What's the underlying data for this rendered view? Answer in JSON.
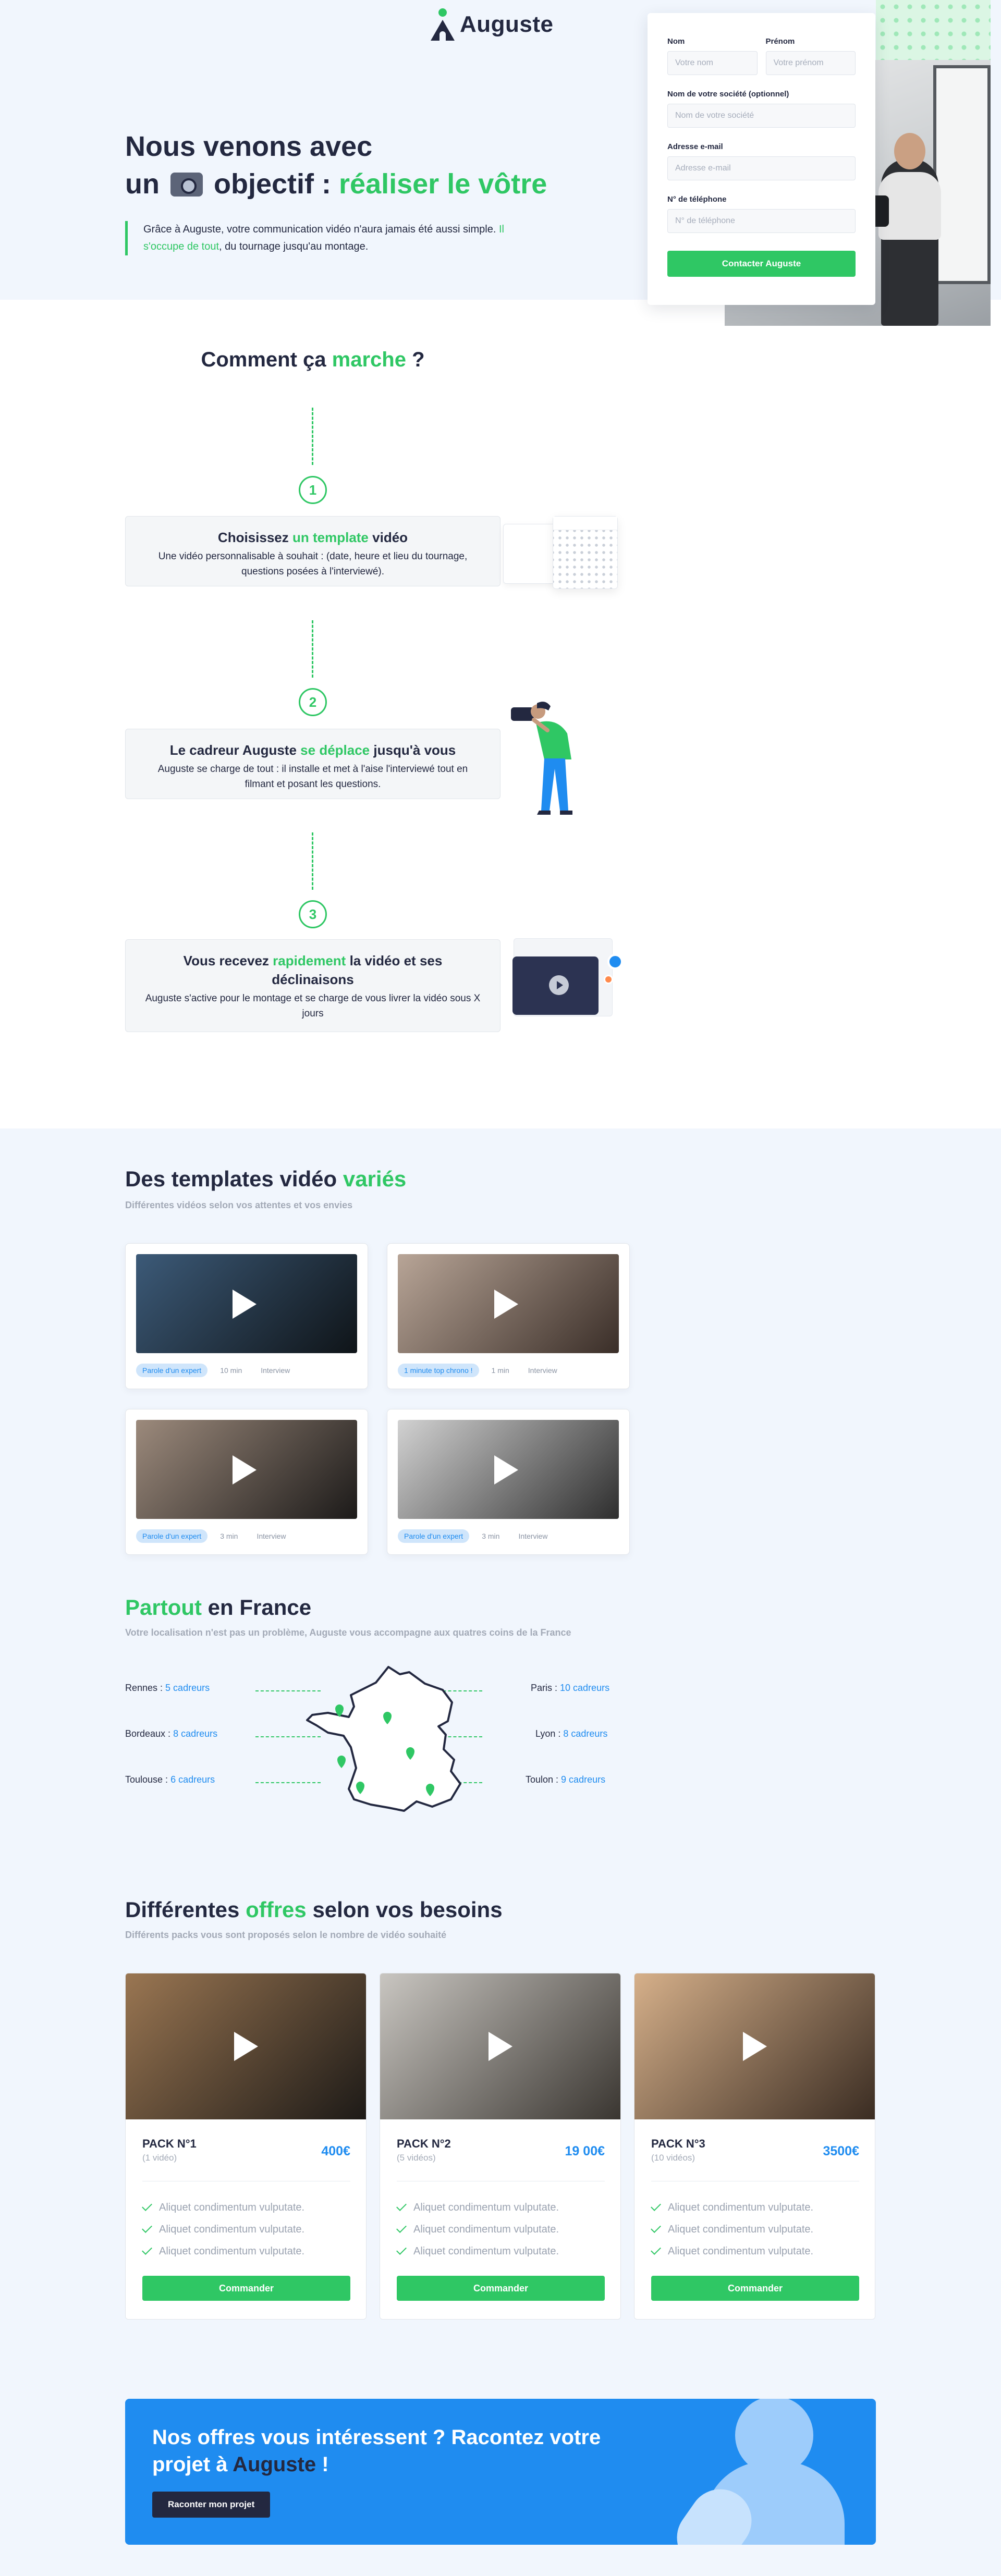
{
  "brand": {
    "name": "Auguste"
  },
  "hero": {
    "title_1": "Nous venons avec",
    "title_2a": "un",
    "title_2b": "objectif :",
    "title_2c": "réaliser le vôtre",
    "quote_a": "Grâce à Auguste, votre communication vidéo n'aura jamais été aussi simple.",
    "quote_b": "Il s'occupe de tout",
    "quote_c": ", du tournage jusqu'au montage."
  },
  "form": {
    "nom_label": "Nom",
    "nom_placeholder": "Votre nom",
    "prenom_label": "Prénom",
    "prenom_placeholder": "Votre prénom",
    "societe_label": "Nom de votre société (optionnel)",
    "societe_placeholder": "Nom de votre société",
    "email_label": "Adresse e-mail",
    "email_placeholder": "Adresse e-mail",
    "tel_label": "N° de téléphone",
    "tel_placeholder": "N° de téléphone",
    "submit": "Contacter Auguste"
  },
  "how": {
    "title_a": "Comment ça",
    "title_b": "marche",
    "title_c": "?",
    "steps": [
      {
        "num": "1",
        "title_a": "Choisissez",
        "title_b": "un template",
        "title_c": "vidéo",
        "text": "Une vidéo personnalisable à souhait : (date, heure et lieu du tournage, questions posées à l'interviewé)."
      },
      {
        "num": "2",
        "title_a": "Le cadreur Auguste",
        "title_b": "se déplace",
        "title_c": "jusqu'à vous",
        "text": "Auguste se charge de tout : il installe et met à l'aise l'interviewé tout en filmant et posant les questions."
      },
      {
        "num": "3",
        "title_a": "Vous recevez",
        "title_b": "rapidement",
        "title_c": "la vidéo et ses déclinaisons",
        "text": "Auguste s'active pour le montage et se charge de vous livrer la vidéo sous X jours"
      }
    ]
  },
  "templates": {
    "title_a": "Des templates vidéo",
    "title_b": "variés",
    "subtitle": "Différentes vidéos selon vos attentes et vos envies",
    "cards": [
      {
        "tag": "Parole d'un expert",
        "duration": "10 min",
        "type": "Interview"
      },
      {
        "tag": "1 minute top chrono !",
        "duration": "1 min",
        "type": "Interview"
      },
      {
        "tag": "Parole d'un expert",
        "duration": "3 min",
        "type": "Interview"
      },
      {
        "tag": "Parole d'un expert",
        "duration": "3 min",
        "type": "Interview"
      }
    ]
  },
  "france": {
    "title_a": "Partout",
    "title_b": "en France",
    "subtitle": "Votre localisation n'est pas un problème, Auguste vous accompagne aux quatres coins de la France",
    "cities": [
      {
        "name": "Rennes : ",
        "count": "5 cadreurs"
      },
      {
        "name": "Bordeaux : ",
        "count": "8 cadreurs"
      },
      {
        "name": "Toulouse : ",
        "count": "6 cadreurs"
      },
      {
        "name": "Paris : ",
        "count": "10 cadreurs"
      },
      {
        "name": "Lyon : ",
        "count": "8 cadreurs"
      },
      {
        "name": "Toulon : ",
        "count": "9 cadreurs"
      }
    ]
  },
  "offers": {
    "title_a": "Différentes",
    "title_b": "offres",
    "title_c": "selon vos besoins",
    "subtitle": "Différents packs vous sont proposés selon le nombre de vidéo souhaité",
    "packs": [
      {
        "name": "PACK N°1",
        "count": "(1 vidéo)",
        "price": "400€",
        "features": [
          "Aliquet condimentum vulputate.",
          "Aliquet condimentum vulputate.",
          "Aliquet condimentum vulputate."
        ],
        "button": "Commander"
      },
      {
        "name": "PACK N°2",
        "count": "(5 vidéos)",
        "price": "19 00€",
        "features": [
          "Aliquet condimentum vulputate.",
          "Aliquet condimentum vulputate.",
          "Aliquet condimentum vulputate."
        ],
        "button": "Commander"
      },
      {
        "name": "PACK N°3",
        "count": "(10 vidéos)",
        "price": "3500€",
        "features": [
          "Aliquet condimentum vulputate.",
          "Aliquet condimentum vulputate.",
          "Aliquet condimentum vulputate."
        ],
        "button": "Commander"
      }
    ]
  },
  "cta": {
    "title_a": "Nos offres vous intéressent ? Racontez votre projet à",
    "title_b": "Auguste",
    "title_c": "!",
    "button": "Raconter mon projet"
  },
  "colors": {
    "green": "#2fc764",
    "blue": "#1f8cf0",
    "navy": "#232840",
    "light_bg": "#f1f6fd"
  },
  "icons": [
    "play-icon",
    "check-icon",
    "map-pin-icon",
    "camera-emoji-icon"
  ]
}
